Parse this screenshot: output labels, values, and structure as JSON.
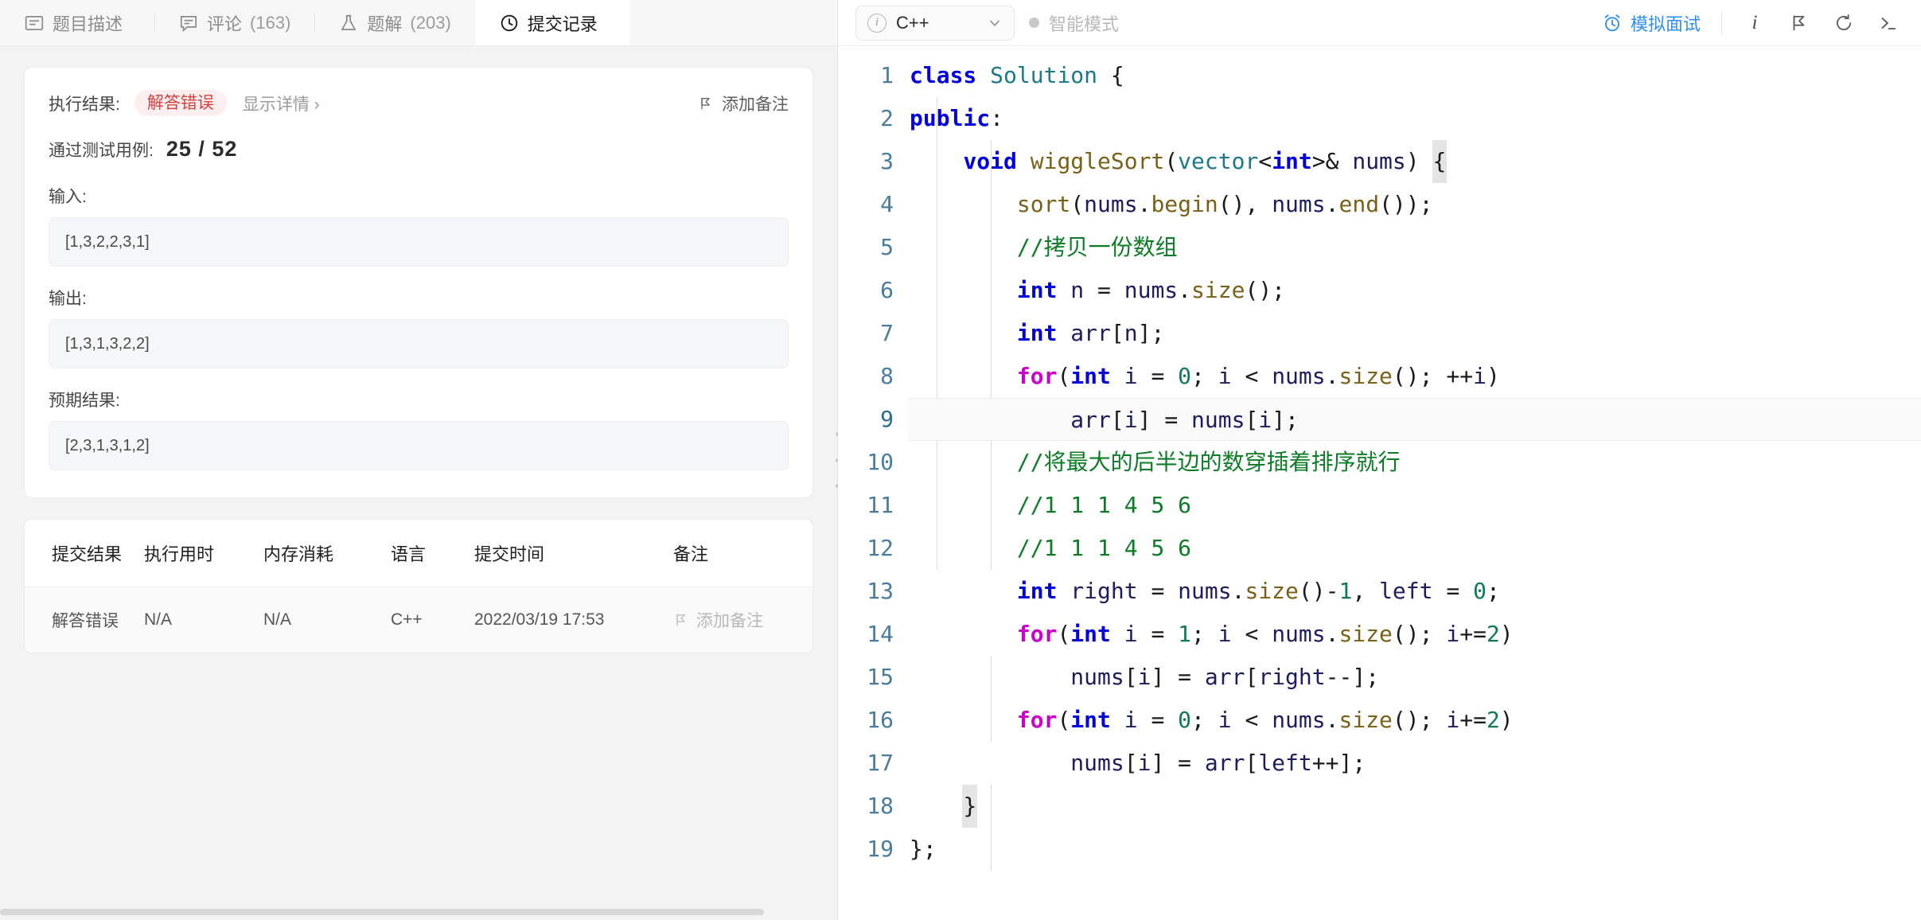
{
  "tabs": [
    {
      "label": "题目描述",
      "count": "",
      "icon": "description-icon",
      "active": false
    },
    {
      "label": "评论",
      "count": "(163)",
      "icon": "comment-icon",
      "active": false
    },
    {
      "label": "题解",
      "count": "(203)",
      "icon": "flask-icon",
      "active": false
    },
    {
      "label": "提交记录",
      "count": "",
      "icon": "clock-icon",
      "active": true
    }
  ],
  "result": {
    "exec_label": "执行结果:",
    "status": "解答错误",
    "detail_link": "显示详情 ›",
    "add_note": "添加备注",
    "cases_label": "通过测试用例:",
    "cases_value": "25 / 52",
    "input_label": "输入:",
    "input_value": "[1,3,2,2,3,1]",
    "output_label": "输出:",
    "output_value": "[1,3,1,3,2,2]",
    "expected_label": "预期结果:",
    "expected_value": "[2,3,1,3,1,2]"
  },
  "submissions": {
    "headers": [
      "提交结果",
      "执行用时",
      "内存消耗",
      "语言",
      "提交时间",
      "备注"
    ],
    "rows": [
      {
        "status": "解答错误",
        "runtime": "N/A",
        "memory": "N/A",
        "language": "C++",
        "time": "2022/03/19 17:53",
        "note": "添加备注"
      }
    ]
  },
  "editor": {
    "language": "C++",
    "smart_mode": "智能模式",
    "mock_interview": "模拟面试",
    "tools": [
      "info-icon",
      "flag-icon",
      "reset-icon",
      "console-icon"
    ],
    "code_lines": [
      {
        "n": 1,
        "text": "class Solution {"
      },
      {
        "n": 2,
        "text": "public:"
      },
      {
        "n": 3,
        "text": "    void wiggleSort(vector<int>& nums) {"
      },
      {
        "n": 4,
        "text": "        sort(nums.begin(), nums.end());"
      },
      {
        "n": 5,
        "text": "        //拷贝一份数组"
      },
      {
        "n": 6,
        "text": "        int n = nums.size();"
      },
      {
        "n": 7,
        "text": "        int arr[n];"
      },
      {
        "n": 8,
        "text": "        for(int i = 0; i < nums.size(); ++i)"
      },
      {
        "n": 9,
        "text": "            arr[i] = nums[i];"
      },
      {
        "n": 10,
        "text": "        //将最大的后半边的数穿插着排序就行"
      },
      {
        "n": 11,
        "text": "        //1 1 1 4 5 6"
      },
      {
        "n": 12,
        "text": "        //1 1 1 4 5 6"
      },
      {
        "n": 13,
        "text": "        int right = nums.size()-1, left = 0;"
      },
      {
        "n": 14,
        "text": "        for(int i = 1; i < nums.size(); i+=2)"
      },
      {
        "n": 15,
        "text": "            nums[i] = arr[right--];"
      },
      {
        "n": 16,
        "text": "        for(int i = 0; i < nums.size(); i+=2)"
      },
      {
        "n": 17,
        "text": "            nums[i] = arr[left++];"
      },
      {
        "n": 18,
        "text": "    }"
      },
      {
        "n": 19,
        "text": "};"
      }
    ],
    "active_line": 9
  },
  "colors": {
    "accent": "#2f8ef4",
    "error": "#e03c3c",
    "badge_bg": "#fdeff0",
    "keyword": "#0000e0",
    "comment": "#0c7d26",
    "function": "#7a6117",
    "type": "#1a7a8c",
    "number": "#0f7a55",
    "gutter": "#4a7d9d"
  }
}
